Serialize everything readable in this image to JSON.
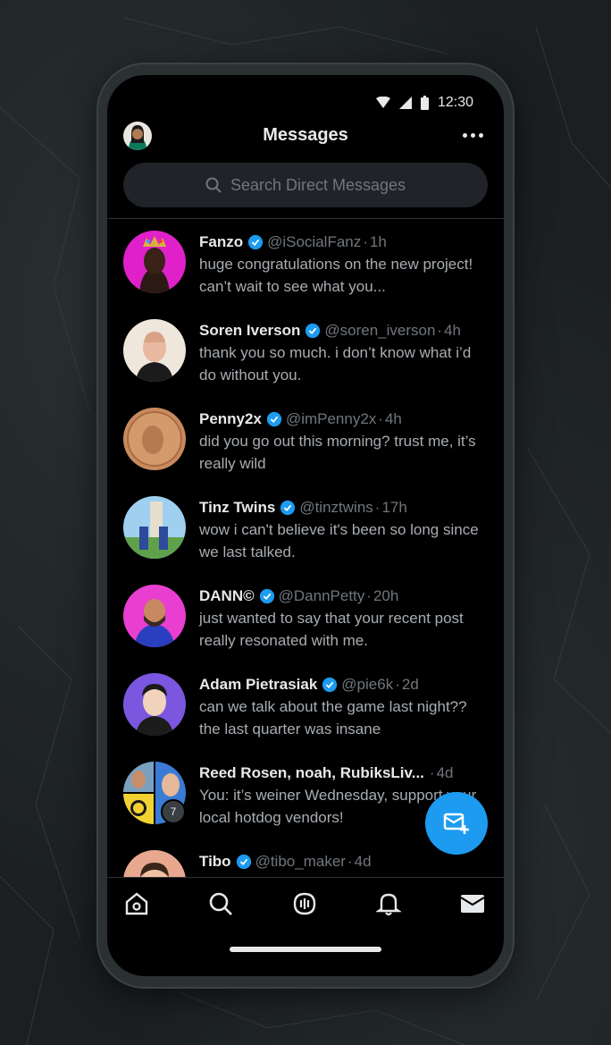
{
  "status": {
    "time": "12:30"
  },
  "header": {
    "title": "Messages"
  },
  "search": {
    "placeholder": "Search Direct Messages"
  },
  "conversations": [
    {
      "name": "Fanzo",
      "verified": true,
      "handle": "@iSocialFanz",
      "time": "1h",
      "preview": "huge congratulations on the new project! can’t wait to see what you..."
    },
    {
      "name": "Soren Iverson",
      "verified": true,
      "handle": "@soren_iverson",
      "time": "4h",
      "preview": "thank you so much. i don’t know what i’d do without you."
    },
    {
      "name": "Penny2x",
      "verified": true,
      "handle": "@imPenny2x",
      "time": "4h",
      "preview": "did you go out this morning? trust me, it’s really wild"
    },
    {
      "name": "Tinz Twins",
      "verified": true,
      "handle": "@tinztwins",
      "time": "17h",
      "preview": "wow i can't believe it's been so long since we last talked."
    },
    {
      "name": "DANN©",
      "verified": true,
      "handle": "@DannPetty",
      "time": "20h",
      "preview": "just wanted to say that your recent post really resonated with me."
    },
    {
      "name": "Adam Pietrasiak",
      "verified": true,
      "handle": "@pie6k",
      "time": "2d",
      "preview": "can we talk about the game last night?? the last quarter was insane"
    },
    {
      "name": "Reed Rosen, noah, RubiksLiv...",
      "verified": false,
      "handle": "",
      "time": "4d",
      "preview": "You: it’s weiner Wednesday, support your local hotdog vendors!",
      "group_count": "7"
    },
    {
      "name": "Tibo",
      "verified": true,
      "handle": "@tibo_maker",
      "time": "4d",
      "preview": ""
    }
  ],
  "fab": {
    "icon": "new-message-icon"
  },
  "tabs": [
    {
      "icon": "home-icon"
    },
    {
      "icon": "search-icon"
    },
    {
      "icon": "spaces-icon"
    },
    {
      "icon": "bell-icon"
    },
    {
      "icon": "mail-icon"
    }
  ],
  "colors": {
    "accent": "#1d9bf0",
    "background": "#000000",
    "text": "#e7e9ea",
    "muted": "#71767b"
  }
}
